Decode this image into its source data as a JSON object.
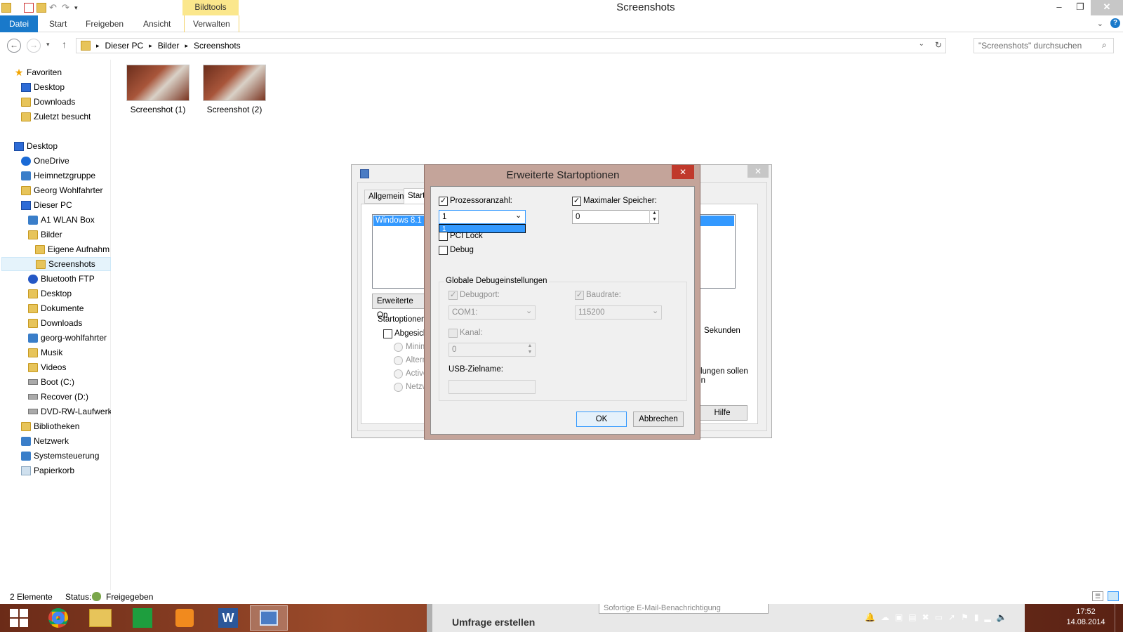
{
  "titlebar": {
    "context_tab": "Bildtools",
    "title": "Screenshots"
  },
  "ribbon": {
    "tabs": [
      "Datei",
      "Start",
      "Freigeben",
      "Ansicht",
      "Verwalten"
    ]
  },
  "address": {
    "path": [
      "Dieser PC",
      "Bilder",
      "Screenshots"
    ],
    "search_placeholder": "\"Screenshots\" durchsuchen"
  },
  "navpane": {
    "items": [
      {
        "label": "Favoriten",
        "icon": "star-icon"
      },
      {
        "label": "Desktop",
        "icon": "monitor-icon"
      },
      {
        "label": "Downloads",
        "icon": "folder-icon"
      },
      {
        "label": "Zuletzt besucht",
        "icon": "folder-icon"
      },
      {
        "label": "Desktop",
        "icon": "monitor-icon"
      },
      {
        "label": "OneDrive",
        "icon": "cloud-icon"
      },
      {
        "label": "Heimnetzgruppe",
        "icon": "network-icon"
      },
      {
        "label": "Georg Wohlfahrter",
        "icon": "folder-icon"
      },
      {
        "label": "Dieser PC",
        "icon": "monitor-icon"
      },
      {
        "label": "A1 WLAN Box",
        "icon": "network-icon"
      },
      {
        "label": "Bilder",
        "icon": "folder-icon"
      },
      {
        "label": "Eigene Aufnahm",
        "icon": "folder-icon"
      },
      {
        "label": "Screenshots",
        "icon": "folder-icon"
      },
      {
        "label": "Bluetooth FTP",
        "icon": "bluetooth-icon"
      },
      {
        "label": "Desktop",
        "icon": "folder-icon"
      },
      {
        "label": "Dokumente",
        "icon": "folder-icon"
      },
      {
        "label": "Downloads",
        "icon": "folder-icon"
      },
      {
        "label": "georg-wohlfahrter",
        "icon": "network-icon"
      },
      {
        "label": "Musik",
        "icon": "folder-icon"
      },
      {
        "label": "Videos",
        "icon": "folder-icon"
      },
      {
        "label": "Boot (C:)",
        "icon": "drive-icon"
      },
      {
        "label": "Recover (D:)",
        "icon": "drive-icon"
      },
      {
        "label": "DVD-RW-Laufwerk",
        "icon": "drive-icon"
      },
      {
        "label": "Bibliotheken",
        "icon": "folder-icon"
      },
      {
        "label": "Netzwerk",
        "icon": "network-icon"
      },
      {
        "label": "Systemsteuerung",
        "icon": "network-icon"
      },
      {
        "label": "Papierkorb",
        "icon": "trash-icon"
      }
    ]
  },
  "files": [
    {
      "name": "Screenshot (1)"
    },
    {
      "name": "Screenshot (2)"
    }
  ],
  "statusbar": {
    "count": "2 Elemente",
    "status_label": "Status:",
    "status_value": "Freigegeben"
  },
  "propdlg": {
    "tabs": [
      "Allgemein",
      "Start"
    ],
    "list_item": "Windows 8.1 (",
    "button_adv": "Erweiterte Op",
    "group_label": "Startoptionen",
    "safe_boot": "Abgesich",
    "radios": [
      "Minima",
      "Altern",
      "Active",
      "Netzw"
    ],
    "seconds": "Sekunden",
    "note_line1": "ellungen sollen",
    "note_line2": "ten",
    "help_button": "Hilfe"
  },
  "dialog": {
    "title": "Erweiterte Startoptionen",
    "proc_label": "Prozessoranzahl:",
    "proc_value": "1",
    "proc_dropdown_option": "1",
    "mem_label": "Maximaler Speicher:",
    "mem_value": "0",
    "pci_label": "PCI Lock",
    "debug_label": "Debug",
    "group_label": "Globale Debugeinstellungen",
    "debugport_label": "Debugport:",
    "debugport_value": "COM1:",
    "baud_label": "Baudrate:",
    "baud_value": "115200",
    "channel_label": "Kanal:",
    "channel_value": "0",
    "usb_label": "USB-Zielname:",
    "ok": "OK",
    "cancel": "Abbrechen"
  },
  "taskbar": {
    "browser_field": "Sofortige E-Mail-Benachrichtigung",
    "browser_heading": "Umfrage erstellen",
    "time": "17:52",
    "date": "14.08.2014"
  }
}
